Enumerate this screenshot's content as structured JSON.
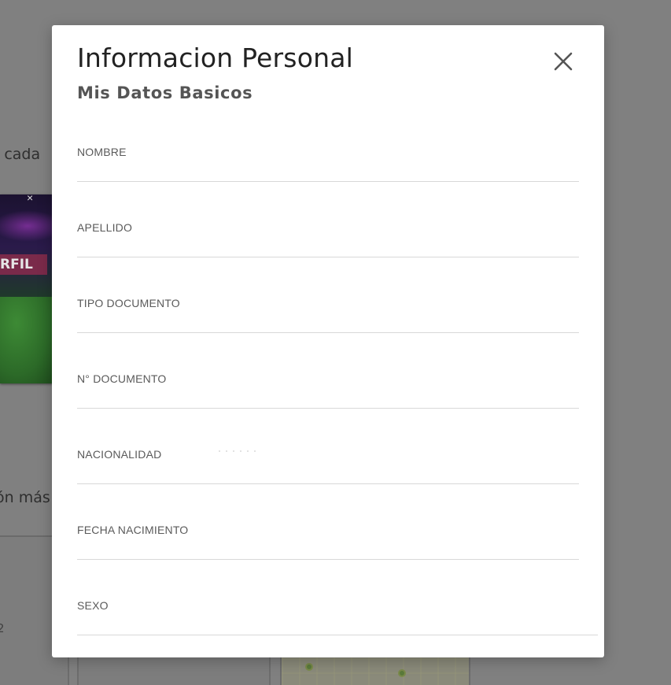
{
  "background": {
    "text_line_1": "l cada",
    "text_line_2": "ón más",
    "text_line_3": "2",
    "banner_label": "RFIL",
    "banner_close": "×"
  },
  "modal": {
    "title": "Informacion Personal",
    "subtitle": "Mis Datos Basicos",
    "close_icon": "close-icon",
    "fields": [
      {
        "label": "NOMBRE",
        "value": ""
      },
      {
        "label": "APELLIDO",
        "value": ""
      },
      {
        "label": "TIPO DOCUMENTO",
        "value": ""
      },
      {
        "label": "N° DOCUMENTO",
        "value": ""
      },
      {
        "label": "NACIONALIDAD",
        "value": ""
      },
      {
        "label": "FECHA NACIMIENTO",
        "value": ""
      },
      {
        "label": "SEXO",
        "value": ""
      }
    ]
  },
  "colors": {
    "overlay": "#808080",
    "modal_bg": "#ffffff",
    "title": "#222222",
    "subtitle": "#555555",
    "label": "#5a5a5a",
    "divider": "#d8d8d8"
  }
}
